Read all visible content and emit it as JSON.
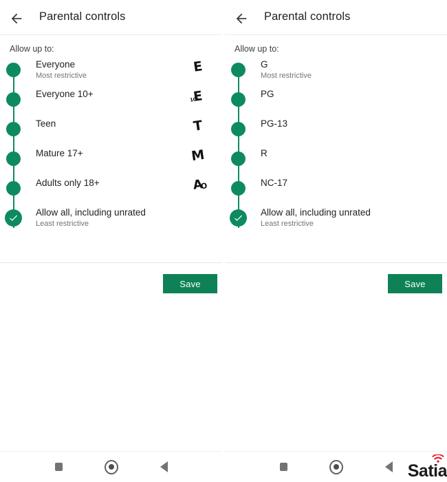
{
  "panels": [
    {
      "id": "esrb",
      "appbar": {
        "back_icon": "back-arrow-icon",
        "title": "Parental controls"
      },
      "allow_label": "Allow up to:",
      "save_label": "Save",
      "items": [
        {
          "title": "Everyone",
          "sub": "Most restrictive",
          "badge": "E",
          "badge_sub": ""
        },
        {
          "title": "Everyone 10+",
          "sub": "",
          "badge": "E",
          "badge_sub": "10+"
        },
        {
          "title": "Teen",
          "sub": "",
          "badge": "T",
          "badge_sub": ""
        },
        {
          "title": "Mature 17+",
          "sub": "",
          "badge": "M",
          "badge_sub": ""
        },
        {
          "title": "Adults only 18+",
          "sub": "",
          "badge": "A",
          "badge_sub": "O"
        },
        {
          "title": "Allow all, including unrated",
          "sub": "Least restrictive",
          "badge": "",
          "badge_sub": "",
          "selected": true
        }
      ]
    },
    {
      "id": "mpaa",
      "appbar": {
        "back_icon": "back-arrow-icon",
        "title": "Parental controls"
      },
      "allow_label": "Allow up to:",
      "save_label": "Save",
      "items": [
        {
          "title": "G",
          "sub": "Most restrictive",
          "badge": "",
          "badge_sub": ""
        },
        {
          "title": "PG",
          "sub": "",
          "badge": "",
          "badge_sub": ""
        },
        {
          "title": "PG-13",
          "sub": "",
          "badge": "",
          "badge_sub": ""
        },
        {
          "title": "R",
          "sub": "",
          "badge": "",
          "badge_sub": ""
        },
        {
          "title": "NC-17",
          "sub": "",
          "badge": "",
          "badge_sub": ""
        },
        {
          "title": "Allow all, including unrated",
          "sub": "Least restrictive",
          "badge": "",
          "badge_sub": "",
          "selected": true
        }
      ]
    }
  ],
  "navbar": {
    "recents_icon": "square-recents-icon",
    "home_icon": "circle-home-icon",
    "back_icon": "triangle-back-icon"
  },
  "watermark": {
    "text": "Satia",
    "icon": "wifi-arc-icon"
  },
  "colors": {
    "accent_green": "#0e8a5f",
    "button_green": "#0e8256",
    "title_text": "#202124",
    "sub_text": "#70757a",
    "watermark_red": "#e8192c"
  }
}
